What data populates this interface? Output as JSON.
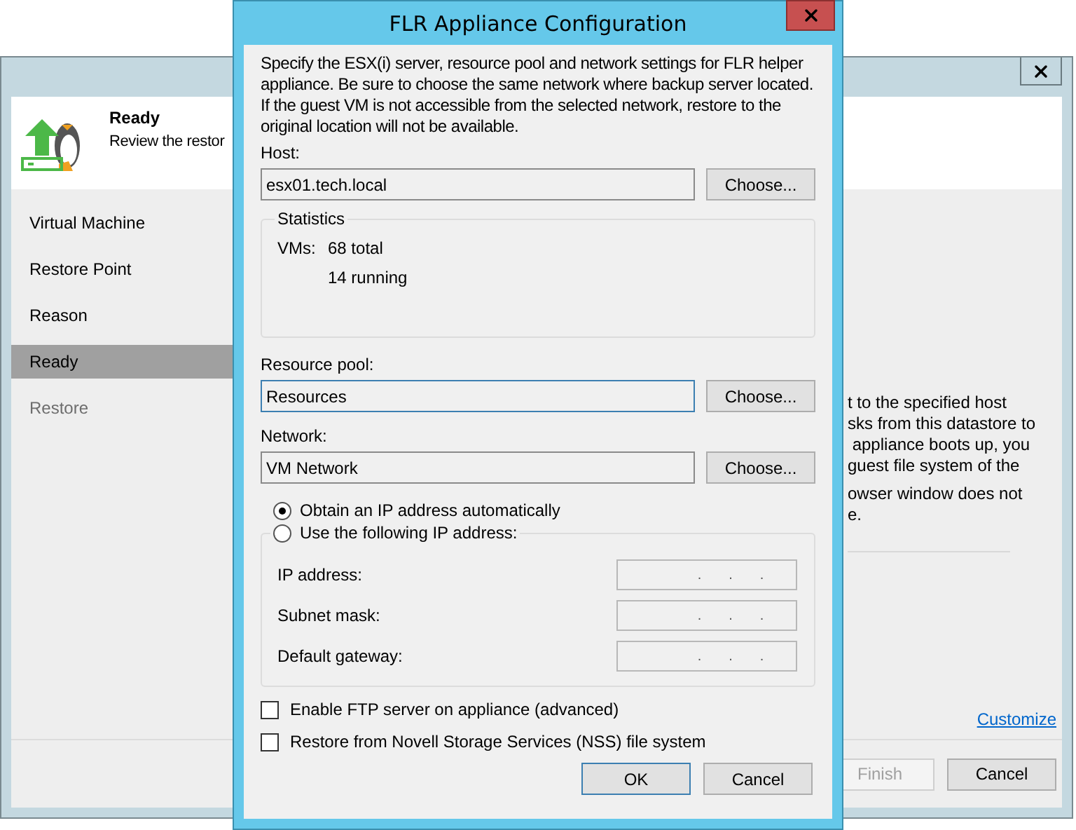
{
  "wizard": {
    "header": {
      "title": "Ready",
      "subtitle": "Review the restor"
    },
    "steps": [
      {
        "label": "Virtual Machine",
        "selected": false,
        "disabled": false
      },
      {
        "label": "Restore Point",
        "selected": false,
        "disabled": false
      },
      {
        "label": "Reason",
        "selected": false,
        "disabled": false
      },
      {
        "label": "Ready",
        "selected": true,
        "disabled": false
      },
      {
        "label": "Restore",
        "selected": false,
        "disabled": true
      }
    ],
    "body_paragraphs": [
      [
        "t to the specified host",
        "sks from this datastore to",
        " appliance boots up, you",
        "guest file system of the"
      ],
      [
        "owser window does not",
        "e."
      ]
    ],
    "link": "Customize",
    "buttons": [
      {
        "label": "Finish",
        "disabled": true
      },
      {
        "label": "Cancel",
        "disabled": false
      }
    ]
  },
  "dialog": {
    "title": "FLR Appliance Configuration",
    "description": "Specify the ESX(i) server, resource pool and network settings for FLR helper appliance. Be sure to choose the same network where backup server located. If the guest VM is not accessible from the selected network, restore to the original location will not be available.",
    "host": {
      "label": "Host:",
      "value": "esx01.tech.local",
      "button": "Choose...",
      "focused": false
    },
    "statistics": {
      "title": "Statistics",
      "label": "VMs:",
      "total": "68 total",
      "running": "14 running"
    },
    "resource_pool": {
      "label": "Resource pool:",
      "value": "Resources",
      "button": "Choose...",
      "focused": true
    },
    "network": {
      "label": "Network:",
      "value": "VM Network",
      "button": "Choose...",
      "focused": false
    },
    "ip_options": [
      {
        "label": "Obtain an IP address automatically",
        "selected": true
      },
      {
        "label": "Use the following IP address:",
        "selected": false
      }
    ],
    "ip_fields": [
      {
        "label": "IP address:",
        "value": ".       .       ."
      },
      {
        "label": "Subnet mask:",
        "value": ".       .       ."
      },
      {
        "label": "Default gateway:",
        "value": ".       .       ."
      }
    ],
    "checkboxes": [
      {
        "label": "Enable FTP server on appliance (advanced)",
        "checked": false
      },
      {
        "label": "Restore from Novell Storage Services (NSS) file system",
        "checked": false
      }
    ],
    "buttons": [
      {
        "label": "OK",
        "default": true
      },
      {
        "label": "Cancel",
        "default": false
      }
    ]
  }
}
